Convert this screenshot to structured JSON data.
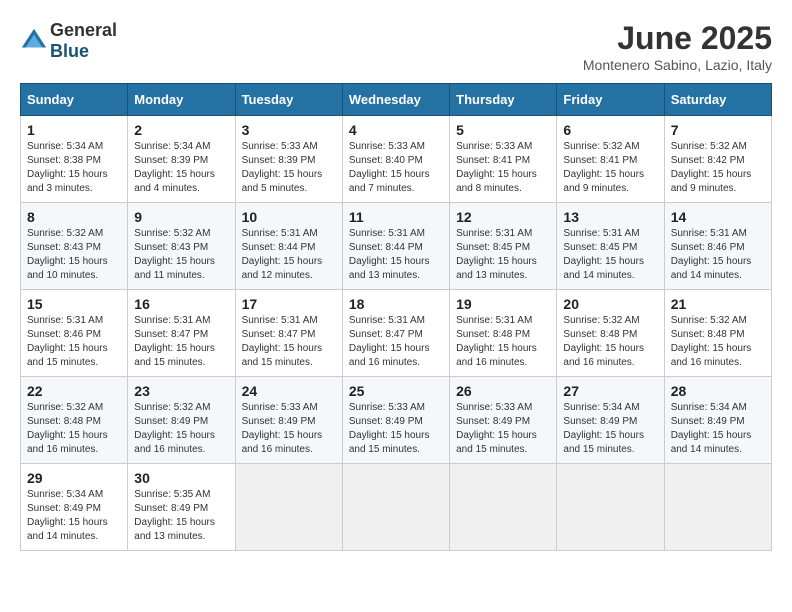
{
  "header": {
    "logo_general": "General",
    "logo_blue": "Blue",
    "month": "June 2025",
    "location": "Montenero Sabino, Lazio, Italy"
  },
  "days_of_week": [
    "Sunday",
    "Monday",
    "Tuesday",
    "Wednesday",
    "Thursday",
    "Friday",
    "Saturday"
  ],
  "weeks": [
    [
      {
        "day": "1",
        "info": "Sunrise: 5:34 AM\nSunset: 8:38 PM\nDaylight: 15 hours\nand 3 minutes."
      },
      {
        "day": "2",
        "info": "Sunrise: 5:34 AM\nSunset: 8:39 PM\nDaylight: 15 hours\nand 4 minutes."
      },
      {
        "day": "3",
        "info": "Sunrise: 5:33 AM\nSunset: 8:39 PM\nDaylight: 15 hours\nand 5 minutes."
      },
      {
        "day": "4",
        "info": "Sunrise: 5:33 AM\nSunset: 8:40 PM\nDaylight: 15 hours\nand 7 minutes."
      },
      {
        "day": "5",
        "info": "Sunrise: 5:33 AM\nSunset: 8:41 PM\nDaylight: 15 hours\nand 8 minutes."
      },
      {
        "day": "6",
        "info": "Sunrise: 5:32 AM\nSunset: 8:41 PM\nDaylight: 15 hours\nand 9 minutes."
      },
      {
        "day": "7",
        "info": "Sunrise: 5:32 AM\nSunset: 8:42 PM\nDaylight: 15 hours\nand 9 minutes."
      }
    ],
    [
      {
        "day": "8",
        "info": "Sunrise: 5:32 AM\nSunset: 8:43 PM\nDaylight: 15 hours\nand 10 minutes."
      },
      {
        "day": "9",
        "info": "Sunrise: 5:32 AM\nSunset: 8:43 PM\nDaylight: 15 hours\nand 11 minutes."
      },
      {
        "day": "10",
        "info": "Sunrise: 5:31 AM\nSunset: 8:44 PM\nDaylight: 15 hours\nand 12 minutes."
      },
      {
        "day": "11",
        "info": "Sunrise: 5:31 AM\nSunset: 8:44 PM\nDaylight: 15 hours\nand 13 minutes."
      },
      {
        "day": "12",
        "info": "Sunrise: 5:31 AM\nSunset: 8:45 PM\nDaylight: 15 hours\nand 13 minutes."
      },
      {
        "day": "13",
        "info": "Sunrise: 5:31 AM\nSunset: 8:45 PM\nDaylight: 15 hours\nand 14 minutes."
      },
      {
        "day": "14",
        "info": "Sunrise: 5:31 AM\nSunset: 8:46 PM\nDaylight: 15 hours\nand 14 minutes."
      }
    ],
    [
      {
        "day": "15",
        "info": "Sunrise: 5:31 AM\nSunset: 8:46 PM\nDaylight: 15 hours\nand 15 minutes."
      },
      {
        "day": "16",
        "info": "Sunrise: 5:31 AM\nSunset: 8:47 PM\nDaylight: 15 hours\nand 15 minutes."
      },
      {
        "day": "17",
        "info": "Sunrise: 5:31 AM\nSunset: 8:47 PM\nDaylight: 15 hours\nand 15 minutes."
      },
      {
        "day": "18",
        "info": "Sunrise: 5:31 AM\nSunset: 8:47 PM\nDaylight: 15 hours\nand 16 minutes."
      },
      {
        "day": "19",
        "info": "Sunrise: 5:31 AM\nSunset: 8:48 PM\nDaylight: 15 hours\nand 16 minutes."
      },
      {
        "day": "20",
        "info": "Sunrise: 5:32 AM\nSunset: 8:48 PM\nDaylight: 15 hours\nand 16 minutes."
      },
      {
        "day": "21",
        "info": "Sunrise: 5:32 AM\nSunset: 8:48 PM\nDaylight: 15 hours\nand 16 minutes."
      }
    ],
    [
      {
        "day": "22",
        "info": "Sunrise: 5:32 AM\nSunset: 8:48 PM\nDaylight: 15 hours\nand 16 minutes."
      },
      {
        "day": "23",
        "info": "Sunrise: 5:32 AM\nSunset: 8:49 PM\nDaylight: 15 hours\nand 16 minutes."
      },
      {
        "day": "24",
        "info": "Sunrise: 5:33 AM\nSunset: 8:49 PM\nDaylight: 15 hours\nand 16 minutes."
      },
      {
        "day": "25",
        "info": "Sunrise: 5:33 AM\nSunset: 8:49 PM\nDaylight: 15 hours\nand 15 minutes."
      },
      {
        "day": "26",
        "info": "Sunrise: 5:33 AM\nSunset: 8:49 PM\nDaylight: 15 hours\nand 15 minutes."
      },
      {
        "day": "27",
        "info": "Sunrise: 5:34 AM\nSunset: 8:49 PM\nDaylight: 15 hours\nand 15 minutes."
      },
      {
        "day": "28",
        "info": "Sunrise: 5:34 AM\nSunset: 8:49 PM\nDaylight: 15 hours\nand 14 minutes."
      }
    ],
    [
      {
        "day": "29",
        "info": "Sunrise: 5:34 AM\nSunset: 8:49 PM\nDaylight: 15 hours\nand 14 minutes."
      },
      {
        "day": "30",
        "info": "Sunrise: 5:35 AM\nSunset: 8:49 PM\nDaylight: 15 hours\nand 13 minutes."
      },
      {
        "day": "",
        "info": ""
      },
      {
        "day": "",
        "info": ""
      },
      {
        "day": "",
        "info": ""
      },
      {
        "day": "",
        "info": ""
      },
      {
        "day": "",
        "info": ""
      }
    ]
  ]
}
